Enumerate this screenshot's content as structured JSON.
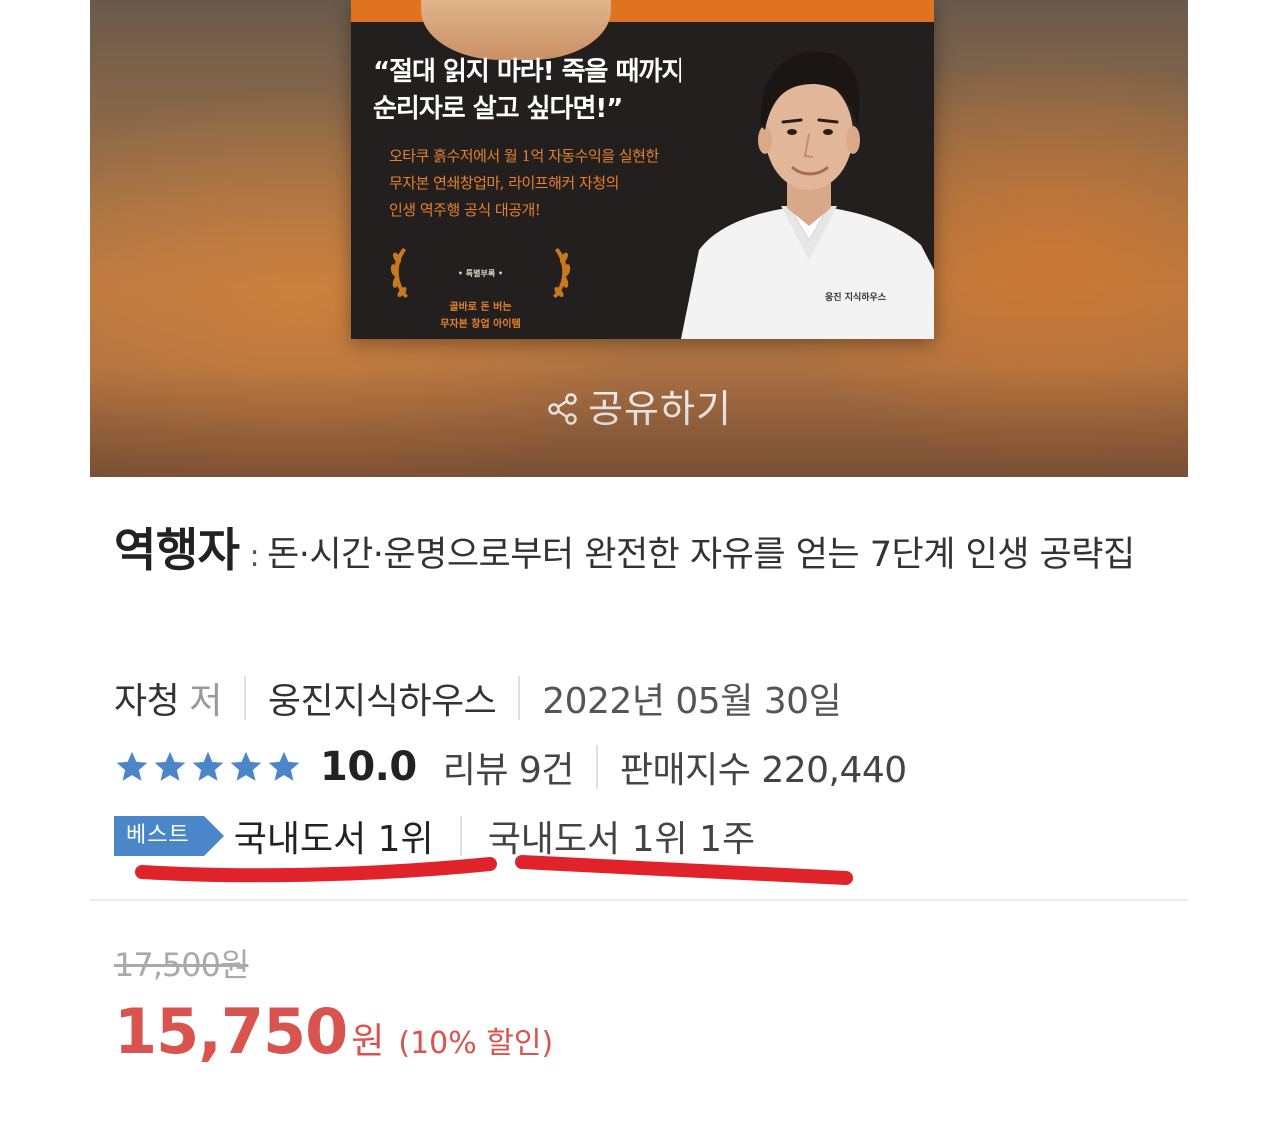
{
  "cover": {
    "quote": "“절대 읽지 마라! 죽을 때까지\n  순리자로 살고 싶다면!”",
    "description": "오타쿠 흙수저에서 월 1억 자동수익을 실현한\n무자본 연쇄창업마, 라이프해커 자청의\n인생 역주행 공식 대공개!",
    "special_label": "• 특별부록 •",
    "special_title": "골바로 돈 버는\n무자본 창업 아이템",
    "publisher_logo": "웅진 지식하우스"
  },
  "share": {
    "label": "공유하기",
    "icon": "share-icon"
  },
  "book": {
    "title": "역행자",
    "subtitle": "돈·시간·운명으로부터 완전한 자유를 얻는 7단계 인생 공략집",
    "author": "자청",
    "author_role": "저",
    "publisher": "웅진지식하우스",
    "date": "2022년 05월 30일"
  },
  "rating": {
    "stars": 5,
    "score": "10.0",
    "reviews": "리뷰 9건",
    "sales_index": "판매지수 220,440",
    "star_color": "#4a86c8"
  },
  "rank": {
    "badge": "베스트",
    "rank1": "국내도서 1위",
    "rank2": "국내도서 1위 1주",
    "badge_color": "#4a86c8",
    "underline_color": "#e0232a"
  },
  "price": {
    "original": "17,500원",
    "sale": "15,750",
    "currency": "원",
    "discount": "(10% 할인)",
    "sale_color": "#d9534f"
  }
}
